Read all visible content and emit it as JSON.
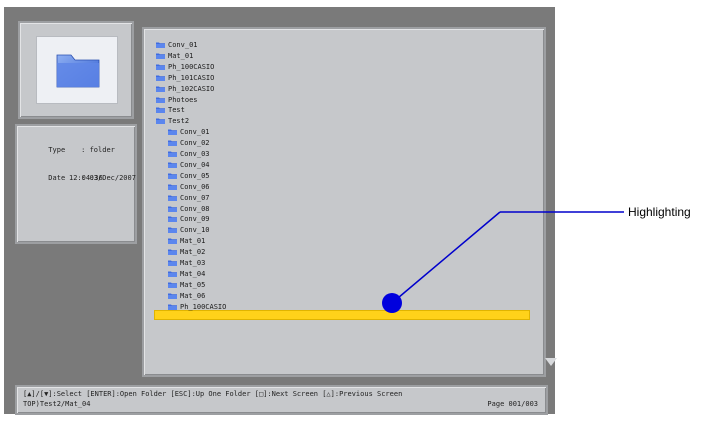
{
  "preview": {
    "thumbnail_icon": "folder-icon"
  },
  "info": {
    "type_label": "Type",
    "type_value": ": folder",
    "date_label": "Date",
    "date_value": ": 03/Dec/2007",
    "time_value": "12:04:36"
  },
  "file_list": {
    "items": [
      {
        "label": "Conv_01",
        "indent": 0
      },
      {
        "label": "Mat_01",
        "indent": 0
      },
      {
        "label": "Ph_100CASIO",
        "indent": 0
      },
      {
        "label": "Ph_101CASIO",
        "indent": 0
      },
      {
        "label": "Ph_102CASIO",
        "indent": 0
      },
      {
        "label": "Photoes",
        "indent": 0
      },
      {
        "label": "Test",
        "indent": 0
      },
      {
        "label": "Test2",
        "indent": 0
      },
      {
        "label": "Conv_01",
        "indent": 1
      },
      {
        "label": "Conv_02",
        "indent": 1
      },
      {
        "label": "Conv_03",
        "indent": 1
      },
      {
        "label": "Conv_04",
        "indent": 1
      },
      {
        "label": "Conv_05",
        "indent": 1
      },
      {
        "label": "Conv_06",
        "indent": 1
      },
      {
        "label": "Conv_07",
        "indent": 1
      },
      {
        "label": "Conv_08",
        "indent": 1
      },
      {
        "label": "Conv_09",
        "indent": 1
      },
      {
        "label": "Conv_10",
        "indent": 1
      },
      {
        "label": "Mat_01",
        "indent": 1
      },
      {
        "label": "Mat_02",
        "indent": 1
      },
      {
        "label": "Mat_03",
        "indent": 1
      },
      {
        "label": "Mat_04",
        "indent": 1,
        "selected": true
      },
      {
        "label": "Mat_05",
        "indent": 1
      },
      {
        "label": "Mat_06",
        "indent": 1
      },
      {
        "label": "Ph_100CASIO",
        "indent": 1
      }
    ],
    "folder_icon": "folder-icon",
    "scroll_indicator": "down-arrow-icon"
  },
  "status_bar": {
    "help_text": "[▲]/[▼]:Select [ENTER]:Open Folder [ESC]:Up One Folder [□]:Next Screen [△]:Previous Screen",
    "path": "TOP)Test2/Mat_04",
    "page": "Page 001/003"
  },
  "annotation": {
    "label": "Highlighting",
    "color": "#0000cc"
  },
  "colors": {
    "highlight": "#ffd21a",
    "background": "#7a7a7a",
    "panel": "#c6c8cb"
  }
}
